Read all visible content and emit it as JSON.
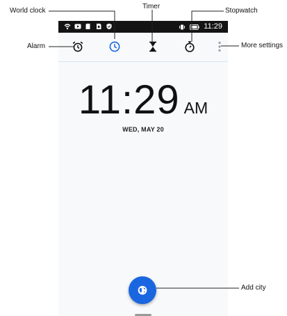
{
  "status_bar": {
    "time": "11:29",
    "left_icons": [
      "wifi-icon",
      "youtube-icon",
      "sd-card-icon",
      "sim-icon",
      "shield-icon"
    ],
    "right_icons": [
      "vibrate-icon",
      "battery-icon"
    ]
  },
  "toolbar": {
    "tabs": [
      {
        "name": "alarm",
        "icon": "alarm-icon",
        "active": false
      },
      {
        "name": "world-clock",
        "icon": "clock-icon",
        "active": true
      },
      {
        "name": "timer",
        "icon": "hourglass-icon",
        "active": false
      },
      {
        "name": "stopwatch",
        "icon": "stopwatch-icon",
        "active": false
      }
    ],
    "more_icon": "more-vert-icon"
  },
  "clock": {
    "time": "11:29",
    "ampm": "AM",
    "date": "WED, MAY 20"
  },
  "fab": {
    "icon": "globe-icon"
  },
  "annotations": {
    "world_clock": "World clock",
    "timer": "Timer",
    "stopwatch": "Stopwatch",
    "alarm": "Alarm",
    "more_settings": "More settings",
    "add_city": "Add city"
  },
  "colors": {
    "accent": "#1a66e0",
    "status_bar": "#141414",
    "background": "#f7f9fb"
  }
}
